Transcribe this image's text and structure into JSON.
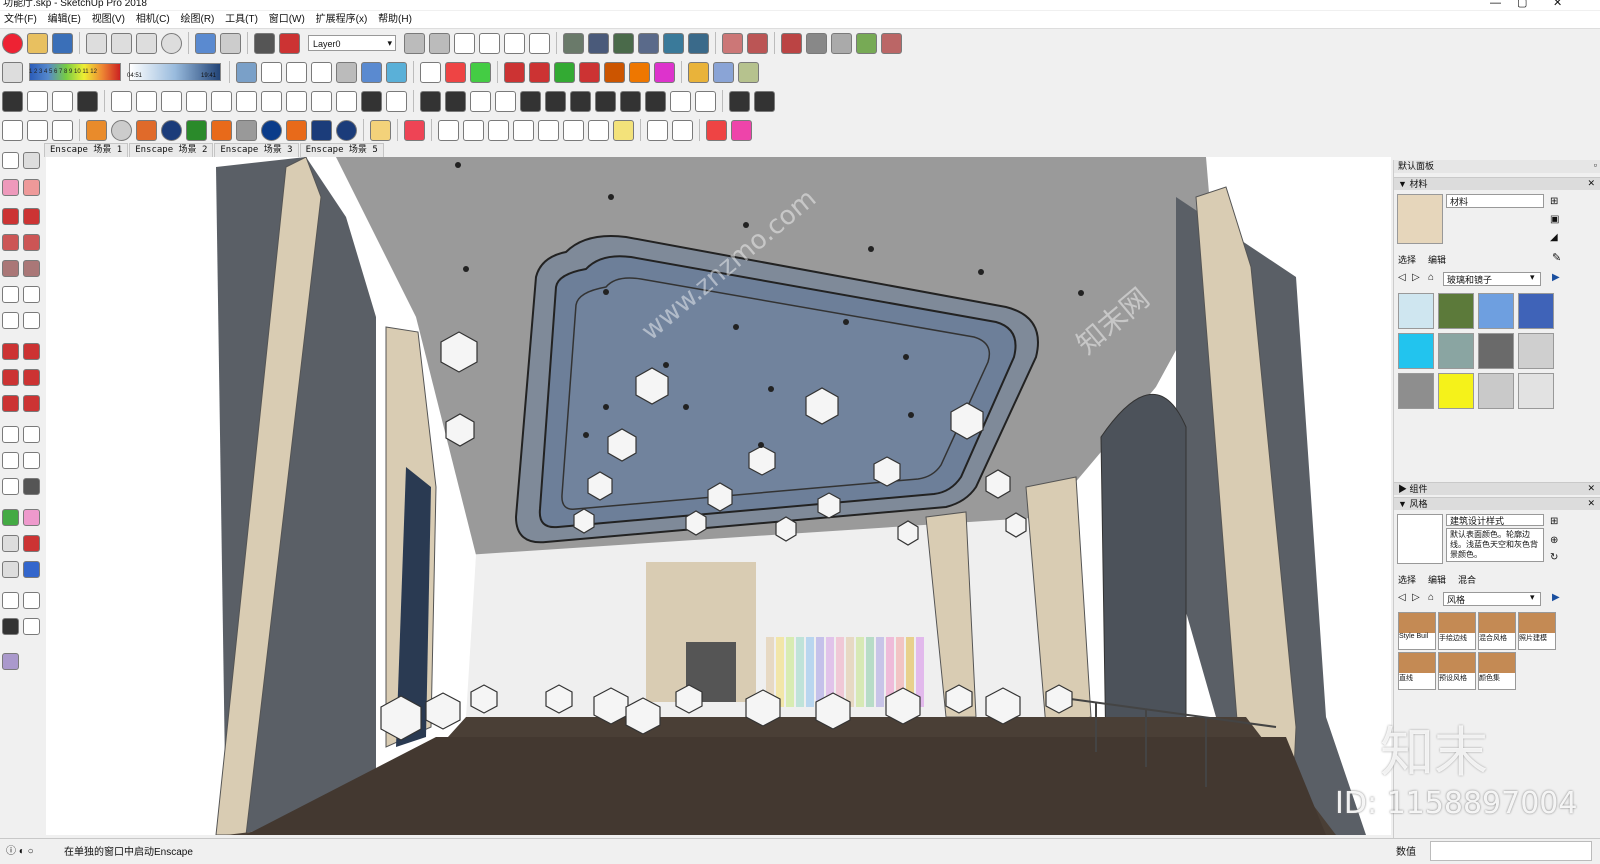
{
  "window": {
    "title": "功能厅.skp - SketchUp Pro 2018"
  },
  "menu": [
    "文件(F)",
    "编辑(E)",
    "视图(V)",
    "相机(C)",
    "绘图(R)",
    "工具(T)",
    "窗口(W)",
    "扩展程序(x)",
    "帮助(H)"
  ],
  "layer": {
    "current": "Layer0"
  },
  "gradient_labels": {
    "a": "1 2 3 4 5 6 7 8 9 10 11 12",
    "b": "04:51",
    "c": "19:41"
  },
  "scenes": [
    "Enscape 场景 1",
    "Enscape 场景 2",
    "Enscape 场景 3",
    "Enscape 场景 5"
  ],
  "panel": {
    "title": "默认面板",
    "materials": {
      "header": "材料",
      "name": "材料",
      "tab_select": "选择",
      "tab_edit": "编辑",
      "library": "玻璃和镜子",
      "swatch_colors": [
        "#cfe6f0",
        "#5c7a3a",
        "#6e9fe0",
        "#3f63b8",
        "#22c4ee",
        "#8aa5a2",
        "#6a6a6a",
        "#cfcfcf",
        "#8e8e8e",
        "#f5f21a",
        "#c9c9c9",
        "#e2e2e2"
      ]
    },
    "components": {
      "header": "组件"
    },
    "styles": {
      "header": "风格",
      "name": "建筑设计样式",
      "desc": "默认表面颜色。轮廓边线。浅蓝色天空和灰色背景颜色。",
      "tab_select": "选择",
      "tab_edit": "编辑",
      "tab_mix": "混合",
      "library": "风格",
      "items": [
        "Style Buil",
        "手绘边线",
        "混合风格",
        "照片建模",
        "直线",
        "预设风格",
        "颜色集"
      ]
    }
  },
  "status": {
    "text": "在单独的窗口中启动Enscape",
    "value_label": "数值"
  },
  "watermark": {
    "brand": "知末",
    "id": "ID: 1158897004",
    "site": "www.znzmo.com",
    "cn": "知末网"
  },
  "colors": {
    "ceiling": "#9a9a9a",
    "ceiling_inner": "#6d7f99",
    "floor": "#4a3f36",
    "wood": "#d9ccb3",
    "wall_dark": "#5a5f66"
  }
}
